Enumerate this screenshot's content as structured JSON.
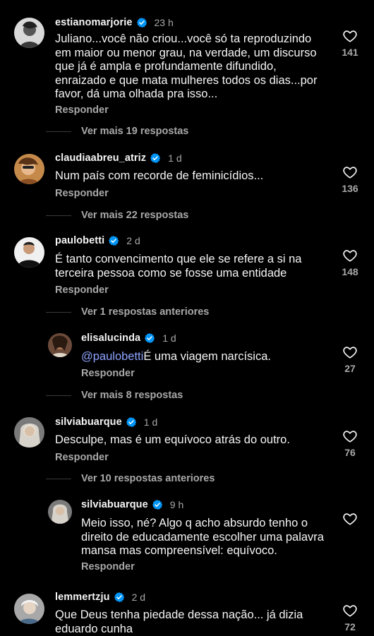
{
  "comments": [
    {
      "username": "estianomarjorie",
      "time": "23 h",
      "text": "Juliano...você não criou...você só ta reproduzindo em maior ou menor grau, na verdade, um discurso que já é ampla e profundamente difundido, enraizado e que mata mulheres todos os dias...por favor, dá uma olhada pra isso...",
      "reply_label": "Responder",
      "likes": "141",
      "thread_label": "Ver mais 19 respostas"
    },
    {
      "username": "claudiaabreu_atriz",
      "time": "1 d",
      "text": "Num país com recorde de feminicídios...",
      "reply_label": "Responder",
      "likes": "136",
      "thread_label": "Ver mais 22 respostas"
    },
    {
      "username": "paulobetti",
      "time": "2 d",
      "text": "É tanto convencimento que ele se refere a si na terceira pessoa como se fosse uma entidade",
      "reply_label": "Responder",
      "likes": "148",
      "thread_label": "Ver 1 respostas anteriores"
    },
    {
      "username": "elisalucinda",
      "time": "1 d",
      "mention": "@paulobetti",
      "text": "É uma viagem narcísica.",
      "reply_label": "Responder",
      "likes": "27",
      "thread_label": "Ver mais 8 respostas"
    },
    {
      "username": "silviabuarque",
      "time": "1 d",
      "text": "Desculpe, mas é um equívoco atrás do outro.",
      "reply_label": "Responder",
      "likes": "76",
      "thread_label": "Ver 10 respostas anteriores"
    },
    {
      "username": "silviabuarque",
      "time": "9 h",
      "text": "Meio isso, né?  Algo q acho absurdo tenho o direito de educadamente escolher uma palavra mansa mas compreensível: equívoco.",
      "reply_label": "Responder",
      "likes": ""
    },
    {
      "username": "lemmertzju",
      "time": "2 d",
      "text": "Que Deus tenha piedade dessa nação... já dizia eduardo cunha",
      "likes": "72"
    }
  ],
  "colors": {
    "background": "#000000",
    "text": "#f5f5f5",
    "secondary": "#a8a8a8",
    "verified": "#0095f6",
    "mention": "#8ea3ff"
  },
  "icons": [
    "verified-badge-icon",
    "heart-icon"
  ]
}
